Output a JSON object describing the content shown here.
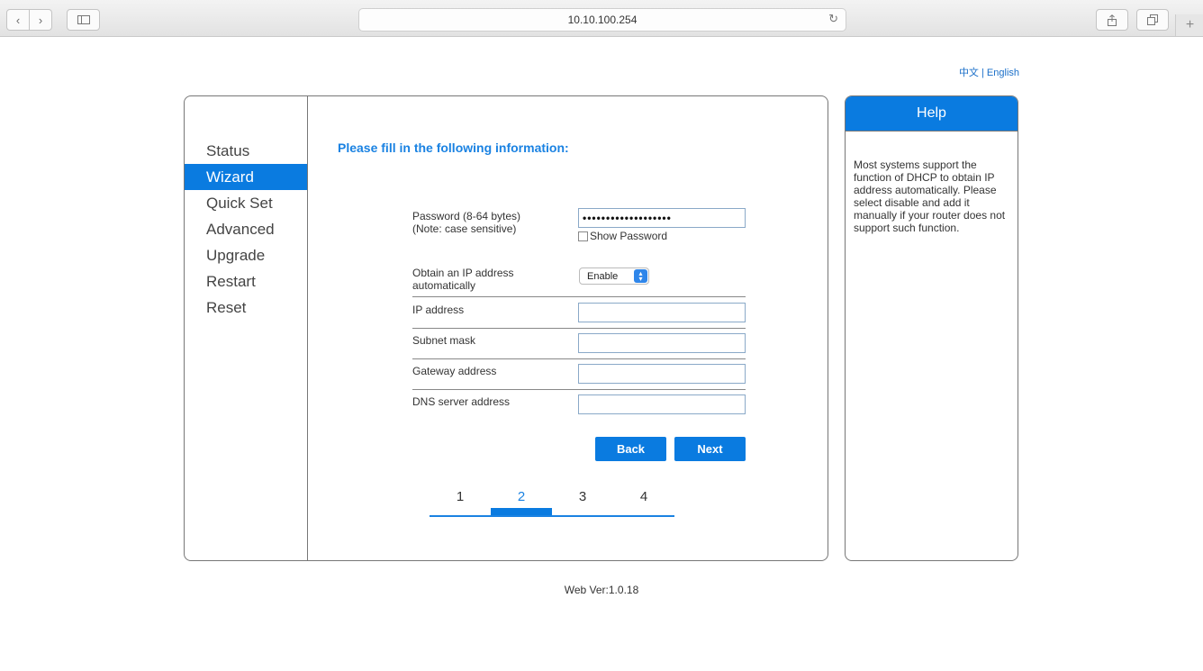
{
  "browser": {
    "url": "10.10.100.254",
    "icons": [
      "back-icon",
      "forward-icon",
      "sidebar-icon",
      "reload-icon",
      "share-icon",
      "tabs-icon",
      "new-tab-icon"
    ]
  },
  "language": {
    "chinese": "中文",
    "separator": " | ",
    "english": "English"
  },
  "sidebar": {
    "items": [
      {
        "label": "Status"
      },
      {
        "label": "Wizard"
      },
      {
        "label": "Quick Set"
      },
      {
        "label": "Advanced"
      },
      {
        "label": "Upgrade"
      },
      {
        "label": "Restart"
      },
      {
        "label": "Reset"
      }
    ],
    "active": "Wizard"
  },
  "form": {
    "heading": "Please fill in the following information:",
    "password_label_line1": "Password (8-64 bytes)",
    "password_label_line2": "(Note: case sensitive)",
    "password_value": "•••••••••••••••••••",
    "show_password_label": "Show Password",
    "dhcp_label_line1": "Obtain an IP address",
    "dhcp_label_line2": "automatically",
    "dhcp_value": "Enable",
    "ip_label": "IP address",
    "subnet_label": "Subnet mask",
    "gateway_label": "Gateway address",
    "dns_label": "DNS server address",
    "back_label": "Back",
    "next_label": "Next"
  },
  "steps": {
    "items": [
      "1",
      "2",
      "3",
      "4"
    ],
    "current": "2"
  },
  "help": {
    "title": "Help",
    "text": "Most systems support the function of DHCP to obtain IP address automatically. Please select disable and add it manually if your router does not support such function."
  },
  "footer": {
    "version": "Web Ver:1.0.18"
  },
  "colors": {
    "accent": "#0a7be0",
    "heading": "#1a82e2",
    "link": "#1a6fc9"
  }
}
